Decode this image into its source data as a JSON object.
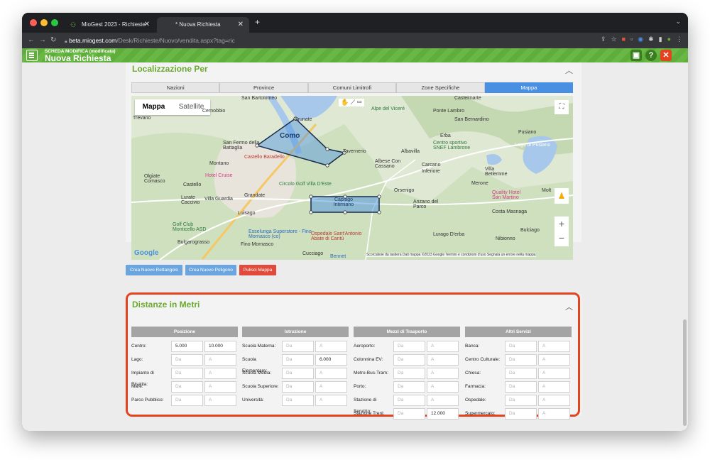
{
  "browser": {
    "tabs": [
      {
        "label": "MioGest 2023 - Richieste"
      },
      {
        "label": "* Nuova Richiesta"
      }
    ],
    "url_host": "beta.miogest.com",
    "url_path": "/Desk/Richieste/Nuovo/vendita.aspx?tag=ric"
  },
  "header": {
    "subtitle": "SCHEDA MODIFICA (modificata)",
    "title": "Nuova Richiesta"
  },
  "localizzazione": {
    "title": "Localizzazione Per",
    "tabs": [
      "Nazioni",
      "Province",
      "Comuni Limitrofi",
      "Zone Specifiche",
      "Mappa"
    ],
    "active_tab": "Mappa",
    "map": {
      "type_buttons": [
        "Mappa",
        "Satellite"
      ],
      "labels": [
        "Como",
        "San Bartolomeo",
        "Brunate",
        "Cernobbio",
        "Castelmarte",
        "Ponte Lambro",
        "San Bernardino",
        "Erba",
        "Pusiano",
        "Alpe del Viceré",
        "Tavernerio",
        "Albavilla",
        "Albese Con Cassano",
        "Carcano",
        "Inferiore",
        "Villa Betlemme",
        "Merone",
        "San Fermo della Battaglia",
        "Castello Baradello",
        "Montano",
        "Hotel Cruise",
        "Olgiate Comasco",
        "Castello",
        "Grandate",
        "Circolo Golf Villa D'Este",
        "Orsenigo",
        "Anzano del Parco",
        "Lurate Caccivio",
        "Villa Guardia",
        "Luisago",
        "Capiago Intimiano",
        "Golf Club Monticello ASD",
        "Bulgarograsso",
        "Esselunga Superstore - Fino Mornasco (co)",
        "Ospedale Sant'Antonio Abate di Cantù",
        "Fino Mornasco",
        "Cucciago",
        "Lurago D'erba",
        "Nibionno",
        "Costa Masnaga",
        "Bulciago",
        "Quality Hotel San Martino",
        "Molt",
        "Centro sportivo SNEF Lambrone",
        "Lago di Pusiano",
        "Bennet",
        "Trevano"
      ],
      "attribution": "Scorciatoie da tastiera   Dati mappa ©2023 Google   Termini e condizioni d'uso   Segnala un errore nella mappa",
      "google": "Google"
    },
    "buttons": [
      "Crea Nuovo Rettangolo",
      "Crea Nuovo Poligono",
      "Pulisci Mappa"
    ]
  },
  "distanze": {
    "title": "Distanze in Metri",
    "columns": [
      {
        "header": "Posizione",
        "rows": [
          {
            "label": "Centro:",
            "da": "5.000",
            "a": "10.000"
          },
          {
            "label": "Lago:",
            "da": "",
            "a": ""
          },
          {
            "label": "Impianto di Risalita:",
            "da": "",
            "a": ""
          },
          {
            "label": "Mare:",
            "da": "",
            "a": ""
          },
          {
            "label": "Parco Pubblico:",
            "da": "",
            "a": ""
          }
        ]
      },
      {
        "header": "Istruzione",
        "rows": [
          {
            "label": "Scuola Materna:",
            "da": "",
            "a": ""
          },
          {
            "label": "Scuola Elementare:",
            "da": "",
            "a": "6.000"
          },
          {
            "label": "Scuola Media:",
            "da": "",
            "a": ""
          },
          {
            "label": "Scuola Superiore:",
            "da": "",
            "a": ""
          },
          {
            "label": "Università:",
            "da": "",
            "a": ""
          }
        ]
      },
      {
        "header": "Mezzi di Trasporto",
        "rows": [
          {
            "label": "Aeroporto:",
            "da": "",
            "a": ""
          },
          {
            "label": "Colonnina EV:",
            "da": "",
            "a": ""
          },
          {
            "label": "Metro-Bus-Tram:",
            "da": "",
            "a": ""
          },
          {
            "label": "Porto:",
            "da": "",
            "a": ""
          },
          {
            "label": "Stazione di Servizio:",
            "da": "",
            "a": ""
          },
          {
            "label": "Stazione Treni:",
            "da": "",
            "a": "12.000"
          }
        ]
      },
      {
        "header": "Altri Servizi",
        "rows": [
          {
            "label": "Banca:",
            "da": "",
            "a": ""
          },
          {
            "label": "Centro Culturale:",
            "da": "",
            "a": ""
          },
          {
            "label": "Chiesa:",
            "da": "",
            "a": ""
          },
          {
            "label": "Farmacia:",
            "da": "",
            "a": ""
          },
          {
            "label": "Ospedale:",
            "da": "",
            "a": ""
          },
          {
            "label": "Supermercato:",
            "da": "",
            "a": ""
          }
        ]
      }
    ],
    "placeholder_da": "Da",
    "placeholder_a": "A"
  },
  "colors": {
    "brand_green": "#6aaa2e",
    "accent_blue": "#4a90e2",
    "danger_red": "#e4431f"
  }
}
